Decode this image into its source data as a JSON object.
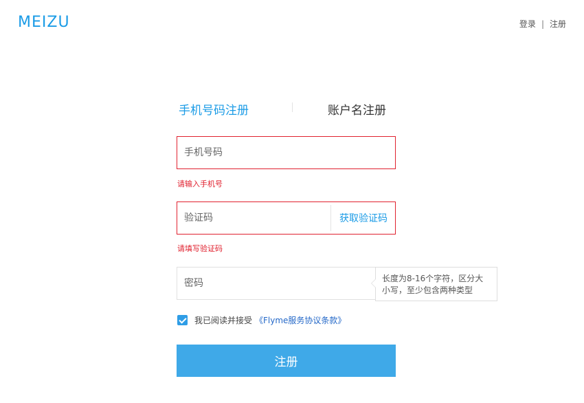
{
  "header": {
    "logo_text": "MEIZU",
    "login_link": "登录",
    "separator": "|",
    "register_link": "注册"
  },
  "tabs": {
    "phone_register": "手机号码注册",
    "account_register": "账户名注册"
  },
  "form": {
    "phone": {
      "placeholder": "手机号码",
      "value": "",
      "error": "请输入手机号"
    },
    "code": {
      "placeholder": "验证码",
      "value": "",
      "get_code_label": "获取验证码",
      "error": "请填写验证码"
    },
    "password": {
      "placeholder": "密码",
      "value": ""
    },
    "password_tooltip": {
      "line1": "长度为8-16个字符，区分大",
      "line2": "小写，至少包含两种类型"
    },
    "agreement": {
      "checked": true,
      "text": "我已阅读并接受",
      "link": "《Flyme服务协议条款》"
    },
    "submit_label": "注册"
  },
  "colors": {
    "accent": "#1a9be6",
    "error": "#e0202e",
    "button": "#3fa9e8"
  }
}
